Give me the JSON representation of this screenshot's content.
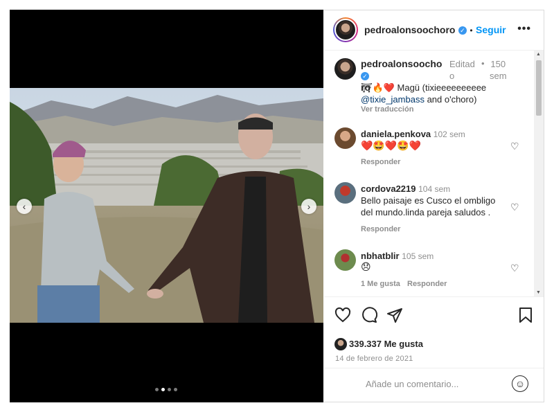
{
  "post": {
    "username": "pedroalonsoochoro",
    "follow_label": "Seguir",
    "more_label": "•••",
    "caption": {
      "username_line1": "pedroalonsoocho",
      "username_line2": "ro",
      "edited_line1": "Editad",
      "edited_line2": "o",
      "dot": "•",
      "time_line1": "150",
      "time_line2": "sem",
      "emoji": "⛩🔥❤️",
      "text_line1": "Magü (tixieeeeeeeeee",
      "mention": "@tixie_jambass",
      "text_line2_rest": " and o'choro)",
      "translate": "Ver traducción"
    },
    "comments": [
      {
        "username": "daniela.penkova",
        "time": "102 sem",
        "text": "❤️🤩❤️🤩❤️",
        "reply": "Responder",
        "likes": ""
      },
      {
        "username": "cordova2219",
        "time": "104 sem",
        "text_line1": "Bello paisaje es Cusco el ombligo",
        "text_line2": "del mundo.linda pareja saludos .",
        "reply": "Responder",
        "likes": ""
      },
      {
        "username": "nbhatblir",
        "time": "105 sem",
        "text": "😞",
        "reply": "Responder",
        "likes": "1 Me gusta"
      }
    ],
    "likes_count": "339.337 Me gusta",
    "date": "14 de febrero de 2021",
    "comment_placeholder": "Añade un comentario...",
    "emoji_button": "☺"
  },
  "carousel": {
    "current": 2,
    "total": 4,
    "prev": "‹",
    "next": "›"
  },
  "colors": {
    "accent": "#0095f6",
    "verified": "#3897f0",
    "heart": "#ed4956"
  }
}
